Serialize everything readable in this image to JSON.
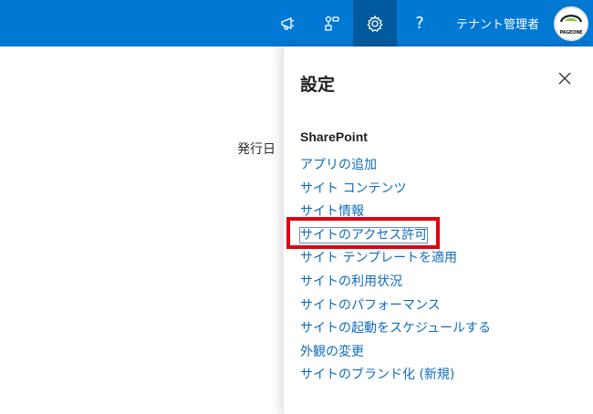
{
  "suite_bar": {
    "background": "#0078d4",
    "icons": [
      "megaphone-icon",
      "app-launcher-icon",
      "gear-icon",
      "help-icon"
    ],
    "help_label": "?",
    "user_name": "テナント管理者",
    "avatar_text": "PAGEONE"
  },
  "page": {
    "partial_text": "発行日"
  },
  "settings_panel": {
    "title": "設定",
    "section_title": "SharePoint",
    "items": [
      "アプリの追加",
      "サイト コンテンツ",
      "サイト情報",
      "サイトのアクセス許可",
      "サイト テンプレートを適用",
      "サイトの利用状況",
      "サイトのパフォーマンス",
      "サイトの起動をスケジュールする",
      "外観の変更",
      "サイトのブランド化 (新規)"
    ],
    "highlighted_item": "サイトのアクセス許可",
    "link_color": "#0f6cbd",
    "highlight_color": "#e3000f"
  }
}
